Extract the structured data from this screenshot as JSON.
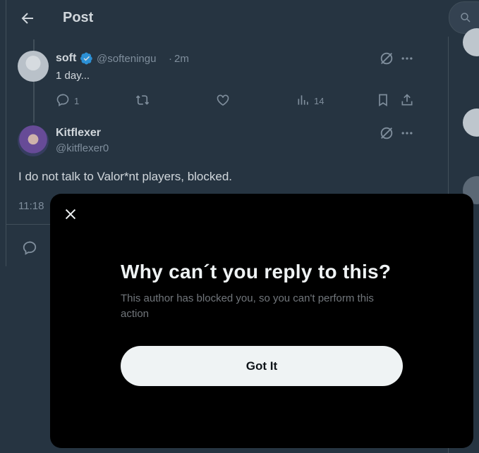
{
  "header": {
    "title": "Post"
  },
  "parent_tweet": {
    "name": "soft",
    "handle": "@softeningu",
    "separator": "·",
    "time": "2m",
    "text": "1 day...",
    "reply_count": "1",
    "view_count": "14"
  },
  "main_tweet": {
    "name": "Kitflexer",
    "handle": "@kitflexer0",
    "text": "I do not talk to Valor*nt players, blocked.",
    "time": "11:18"
  },
  "modal": {
    "title": "Why can´t you reply to this?",
    "body": "This author has blocked you, so you can't perform this action",
    "button": "Got It"
  },
  "colors": {
    "background": "#15202b",
    "modal_bg": "#000000",
    "button_bg": "#eff3f4",
    "verified": "#1d9bf0"
  }
}
